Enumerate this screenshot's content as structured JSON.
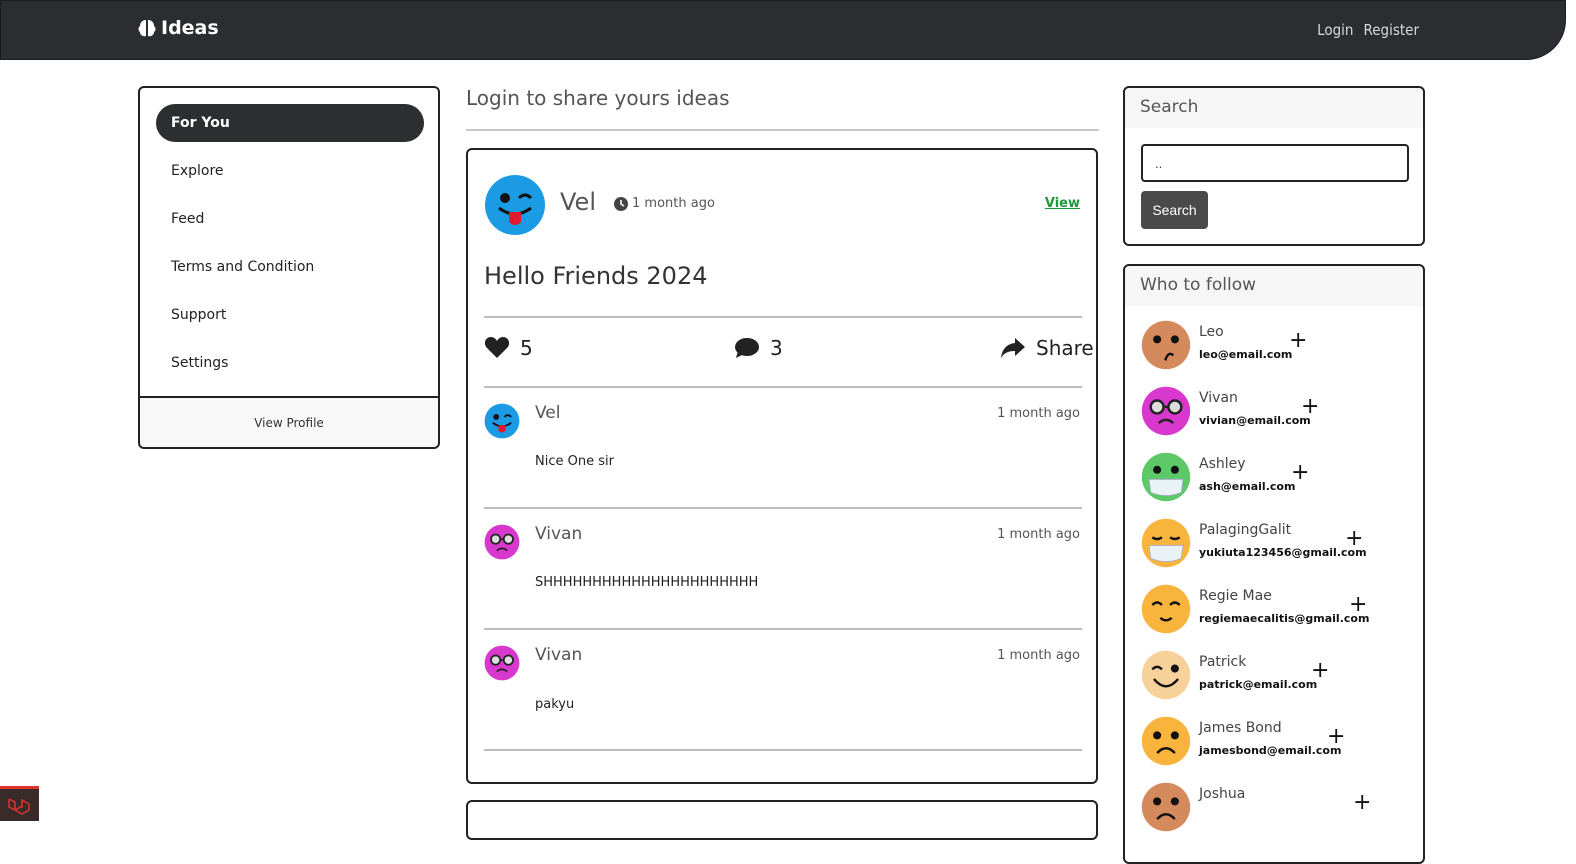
{
  "navbar": {
    "brand": "Ideas",
    "login": "Login",
    "register": "Register"
  },
  "menu": {
    "items": [
      {
        "label": "For You",
        "active": true
      },
      {
        "label": "Explore",
        "active": false
      },
      {
        "label": "Feed",
        "active": false
      },
      {
        "label": "Terms and Condition",
        "active": false
      },
      {
        "label": "Support",
        "active": false
      },
      {
        "label": "Settings",
        "active": false
      }
    ],
    "footer": "View Profile"
  },
  "main": {
    "share_title": "Login to share yours ideas",
    "post": {
      "author": "Vel",
      "time": "1 month ago",
      "view": "View",
      "content": "Hello Friends 2024",
      "likes": "5",
      "comments_count": "3",
      "share": "Share",
      "comments": [
        {
          "name": "Vel",
          "time": "1 month ago",
          "text": "Nice One sir",
          "avatar": "wink-blue"
        },
        {
          "name": "Vivan",
          "time": "1 month ago",
          "text": "SHHHHHHHHHHHHHHHHHHHHHH",
          "avatar": "nerd-pink"
        },
        {
          "name": "Vivan",
          "time": "1 month ago",
          "text": "pakyu",
          "avatar": "nerd-pink"
        }
      ]
    }
  },
  "search": {
    "title": "Search",
    "value": "..",
    "button": "Search"
  },
  "follow": {
    "title": "Who to follow",
    "users": [
      {
        "name": "Leo",
        "email": "leo@email.com",
        "avatar": "confused-brown"
      },
      {
        "name": "Vivan",
        "email": "vivian@email.com",
        "avatar": "nerd-pink"
      },
      {
        "name": "Ashley",
        "email": "ash@email.com",
        "avatar": "mask-green"
      },
      {
        "name": "PalagingGalit",
        "email": "yukiuta123456@gmail.com",
        "avatar": "mask-yellow"
      },
      {
        "name": "Regie Mae",
        "email": "regiemaecalitis@gmail.com",
        "avatar": "happy-yellow"
      },
      {
        "name": "Patrick",
        "email": "patrick@email.com",
        "avatar": "smile-beige"
      },
      {
        "name": "James Bond",
        "email": "jamesbond@email.com",
        "avatar": "sad-yellow"
      },
      {
        "name": "Joshua",
        "email": "",
        "avatar": "sad-brown"
      }
    ],
    "plus": "+"
  },
  "colors": {
    "navbar": "#2b2d30",
    "accent_green": "#1c9a3b",
    "button_dark": "#4a4a4b"
  }
}
